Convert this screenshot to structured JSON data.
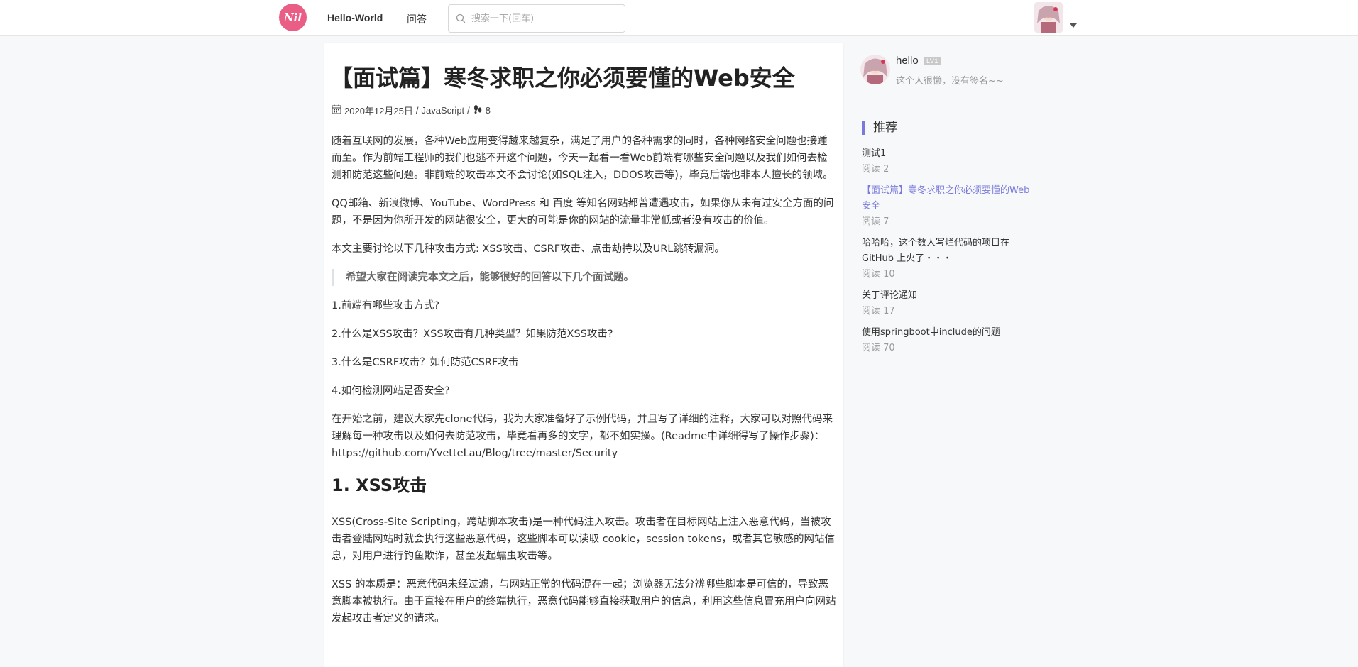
{
  "header": {
    "logo_text": "Nil",
    "nav": [
      {
        "label": "Hello-World"
      },
      {
        "label": "问答"
      }
    ],
    "search": {
      "placeholder": "搜索一下(回车)",
      "value": ""
    }
  },
  "article": {
    "title": "【面试篇】寒冬求职之你必须要懂的Web安全",
    "meta": {
      "date": "2020年12月25日",
      "separator": "/",
      "category": "JavaScript",
      "views": "8"
    },
    "paragraphs": {
      "p1": "随着互联网的发展，各种Web应用变得越来越复杂，满足了用户的各种需求的同时，各种网络安全问题也接踵而至。作为前端工程师的我们也逃不开这个问题，今天一起看一看Web前端有哪些安全问题以及我们如何去检测和防范这些问题。非前端的攻击本文不会讨论(如SQL注入，DDOS攻击等)，毕竟后端也非本人擅长的领域。",
      "p2": "QQ邮箱、新浪微博、YouTube、WordPress 和 百度 等知名网站都曾遭遇攻击，如果你从未有过安全方面的问题，不是因为你所开发的网站很安全，更大的可能是你的网站的流量非常低或者没有攻击的价值。",
      "p3": "本文主要讨论以下几种攻击方式: XSS攻击、CSRF攻击、点击劫持以及URL跳转漏洞。",
      "quote": "希望大家在阅读完本文之后，能够很好的回答以下几个面试题。",
      "q1": "1.前端有哪些攻击方式?",
      "q2": "2.什么是XSS攻击？XSS攻击有几种类型？如果防范XSS攻击?",
      "q3": "3.什么是CSRF攻击？如何防范CSRF攻击",
      "q4": "4.如何检测网站是否安全?",
      "p4": "在开始之前，建议大家先clone代码，我为大家准备好了示例代码，并且写了详细的注释，大家可以对照代码来理解每一种攻击以及如何去防范攻击，毕竟看再多的文字，都不如实操。(Readme中详细得写了操作步骤)：https://github.com/YvetteLau/Blog/tree/master/Security",
      "h2": "1. XSS攻击",
      "p5": "XSS(Cross-Site Scripting，跨站脚本攻击)是一种代码注入攻击。攻击者在目标网站上注入恶意代码，当被攻击者登陆网站时就会执行这些恶意代码，这些脚本可以读取 cookie，session tokens，或者其它敏感的网站信息，对用户进行钓鱼欺诈，甚至发起蠕虫攻击等。",
      "p6": "XSS 的本质是：恶意代码未经过滤，与网站正常的代码混在一起；浏览器无法分辨哪些脚本是可信的，导致恶意脚本被执行。由于直接在用户的终端执行，恶意代码能够直接获取用户的信息，利用这些信息冒充用户向网站发起攻击者定义的请求。"
    }
  },
  "sidebar": {
    "profile": {
      "name": "hello",
      "level": "LV1",
      "signature": "这个人很懒，没有签名~~"
    },
    "recommend_heading": "推荐",
    "recommend": [
      {
        "title": "测试1",
        "reads": "阅读 2",
        "active": false
      },
      {
        "title": "【面试篇】寒冬求职之你必须要懂的Web安全",
        "reads": "阅读 7",
        "active": true
      },
      {
        "title": "哈哈哈，这个数人写烂代码的项目在GitHub 上火了・・・",
        "reads": "阅读 10",
        "active": false
      },
      {
        "title": "关于评论通知",
        "reads": "阅读 17",
        "active": false
      },
      {
        "title": "使用springboot中include的问题",
        "reads": "阅读 70",
        "active": false
      }
    ]
  },
  "colors": {
    "brand": "#ea5e86",
    "accent": "#7a7adb",
    "muted": "#999999"
  },
  "icons": [
    "search-icon",
    "calendar-icon",
    "footprint-icon",
    "caret-down-icon"
  ]
}
